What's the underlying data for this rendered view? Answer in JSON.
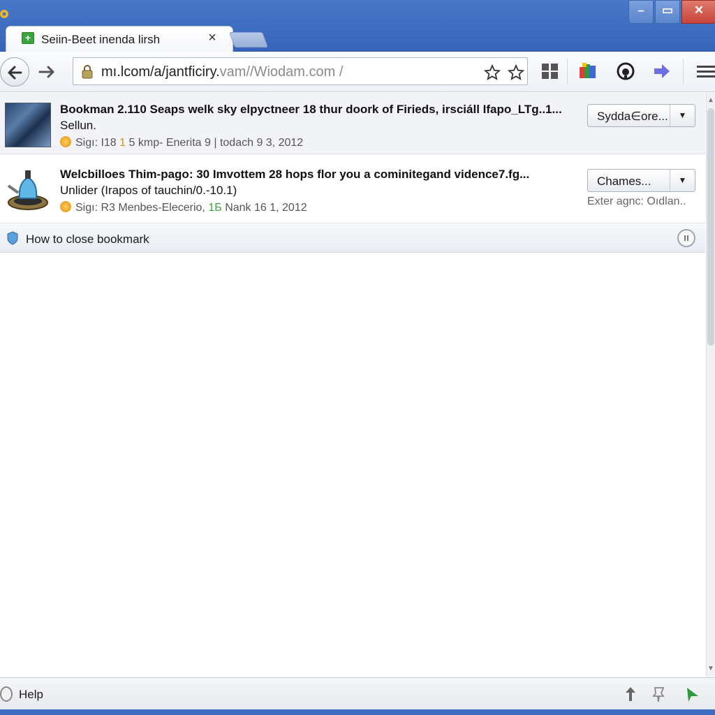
{
  "window": {
    "minimize_glyph": "–",
    "maximize_glyph": "▭",
    "close_glyph": "✕"
  },
  "tab": {
    "title": "Seiin-Beet inenda lirsh",
    "favicon_glyph": "+",
    "close_glyph": "×",
    "icon": "green-plus-favicon"
  },
  "toolbar": {
    "url_main": "mı.lcom/a/jantficiry.",
    "url_rest": "vam//Wiodam.com /",
    "icons": [
      "back-arrow-icon",
      "forward-arrow-icon",
      "lock-icon",
      "star-icon",
      "star-outline-icon",
      "grid-icon",
      "extension-icon",
      "headset-icon",
      "arrow-right-icon",
      "menu-icon"
    ]
  },
  "bookmarks": [
    {
      "title": "Bookman 2.110 Seaps welk sky elpyctneer 18 thur doork of Firieds, irsciáll Ifapo_LTg..1...",
      "subtitle": "Sellun.",
      "meta_prefix": "Sigı: I18",
      "meta_accent": "1",
      "meta_middle": "5 kmp- Enerita 9 |",
      "meta_suffix": "todach 9 3, 2012",
      "button_label": "Sydda∈ore...",
      "note": ""
    },
    {
      "title": "Welcbilloes Thim-pago: 30 Imvottem 28 hops flor you a cominitegand vidence7.fg...",
      "subtitle": "Unlider (Irapos of tauchin/0.-10.1)",
      "meta_prefix": "Sigı: R3",
      "meta_accent": "Menbes-Elecerio,",
      "meta_middle": "1Б",
      "meta_suffix": "Nank 16 1, 2012",
      "button_label": "Chames...",
      "note": "Exter agnc: Oıdlan.."
    }
  ],
  "infobar": {
    "text": "How to close bookmark"
  },
  "statusbar": {
    "help_label": "Help"
  },
  "colors": {
    "titlebar": "#3e6cc0",
    "tab_background": "#ffffff",
    "favicon_green": "#3aa53a",
    "close_red": "#c8443a"
  }
}
